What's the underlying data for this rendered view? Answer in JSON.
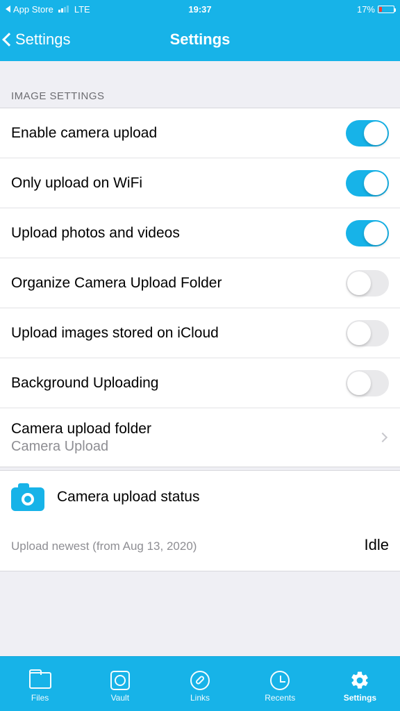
{
  "statusbar": {
    "back_app": "App Store",
    "carrier": "LTE",
    "time": "19:37",
    "battery_pct": "17%"
  },
  "navbar": {
    "back_label": "Settings",
    "title": "Settings"
  },
  "section_header": "IMAGE SETTINGS",
  "rows": {
    "enable_camera_upload": "Enable camera upload",
    "only_wifi": "Only upload on WiFi",
    "photos_videos": "Upload photos and videos",
    "organize_folder": "Organize Camera Upload Folder",
    "icloud": "Upload images stored on iCloud",
    "background": "Background Uploading",
    "folder_title": "Camera upload folder",
    "folder_value": "Camera Upload"
  },
  "status": {
    "title": "Camera upload status",
    "left": "Upload newest (from Aug 13, 2020)",
    "right": "Idle"
  },
  "tabs": {
    "files": "Files",
    "vault": "Vault",
    "links": "Links",
    "recents": "Recents",
    "settings": "Settings"
  }
}
